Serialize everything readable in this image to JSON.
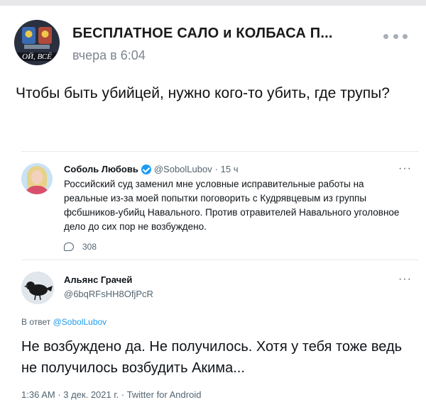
{
  "post": {
    "group_name": "БЕСПЛАТНОЕ САЛО и КОЛБАСА П...",
    "time": "вчера в 6:04",
    "avatar_text": "ОЙ, ВСЁ",
    "text": "Чтобы быть убийцей, нужно кого-то убить, где трупы?",
    "more_icon": "more-horizontal-icon"
  },
  "quoted_tweet": {
    "name": "Соболь Любовь",
    "handle": "@SobolLubov",
    "time": "· 15 ч",
    "text": "Российский суд заменил мне условные исправительные работы на реальные из-за моей попытки поговорить с Кудрявцевым из группы фсбшников-убийц Навального. Против отравителей Навального уголовное дело до сих пор не возбуждено.",
    "reply_count": "308",
    "more": "···"
  },
  "reply_tweet": {
    "name": "Альянс Грачей",
    "handle": "@6bqRFsHH8OfjPcR",
    "replying_prefix": "В ответ",
    "replying_to": "@SobolLubov",
    "text": "Не возбуждено да. Не получилось. Хотя  у тебя тоже ведь не получилось возбудить Акима...",
    "meta": "1:36 AM · 3 дек. 2021 г. · Twitter for Android",
    "more": "···"
  },
  "colors": {
    "accent": "#1d9bf0",
    "secondary_text": "#536471",
    "time_text": "#7d8590"
  }
}
